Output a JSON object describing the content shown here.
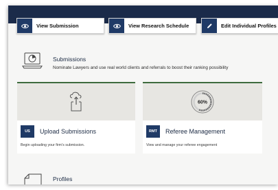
{
  "toolbar": {
    "view_submission": "View Submission",
    "view_research_schedule": "View Research Schedule",
    "edit_individual_profiles": "Edit Individual Profiles"
  },
  "submissions": {
    "title": "Submissions",
    "description": "Nominate Lawyers and use real world clients and referrals to boost their ranking possibility"
  },
  "cards": [
    {
      "badge": "US",
      "title": "Upload Submissions",
      "description": "Begin uploading your firm's submission.",
      "icon": "cloud-upload-icon"
    },
    {
      "badge": "RMT",
      "title": "Referee Management",
      "description": "View and manage your referee engagement",
      "progress_label": "60%",
      "progress_value": 60
    }
  ],
  "profiles": {
    "title": "Profiles"
  },
  "colors": {
    "nav_bg": "#1b2b4a",
    "accent": "#1f3a66",
    "card_border": "#3e6b3e",
    "media_bg": "#e7e6e2"
  }
}
